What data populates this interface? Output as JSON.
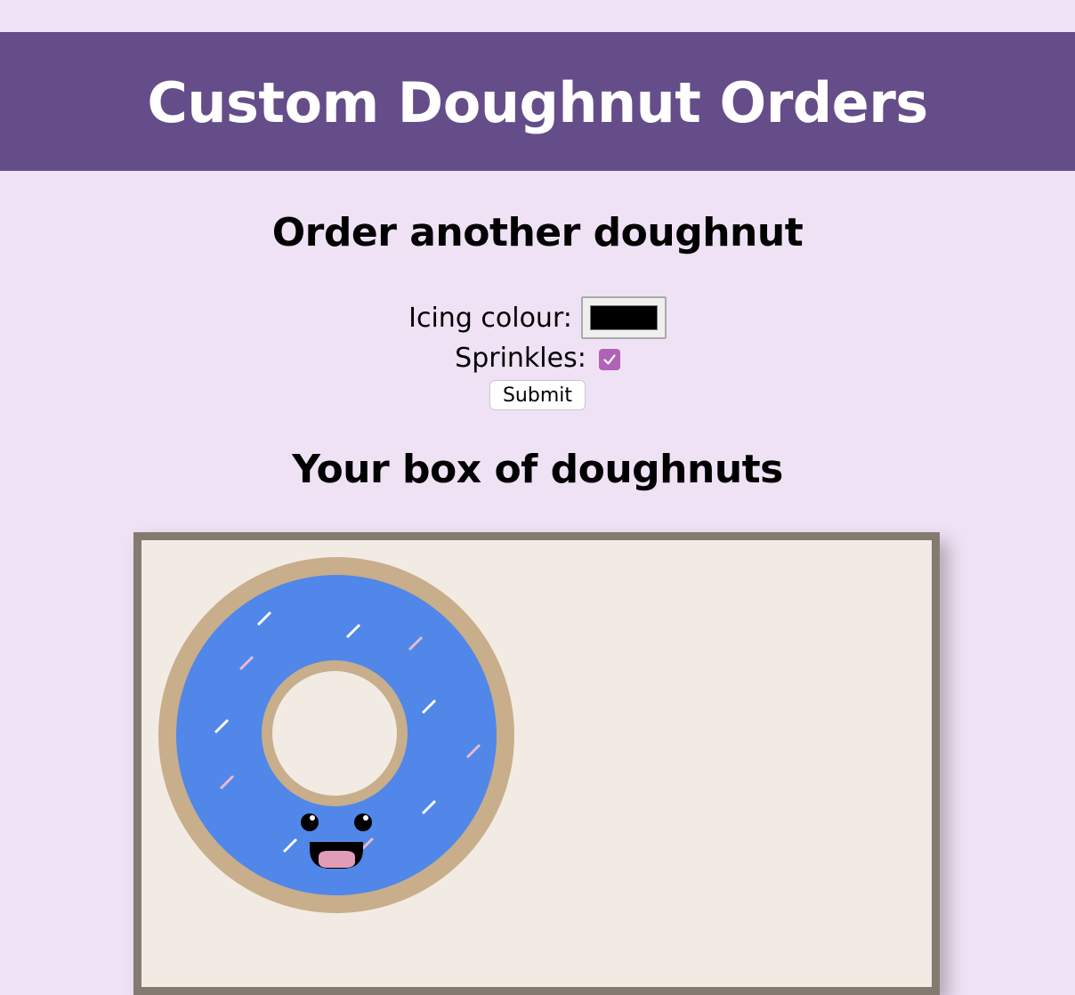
{
  "header": {
    "title": "Custom Doughnut Orders"
  },
  "order_form": {
    "heading": "Order another doughnut",
    "icing_label": "Icing colour:",
    "icing_value": "#000000",
    "sprinkles_label": "Sprinkles:",
    "sprinkles_checked": true,
    "submit_label": "Submit"
  },
  "box": {
    "heading": "Your box of doughnuts",
    "doughnuts": [
      {
        "icing_colour": "#5087e8",
        "sprinkles": true,
        "face": "smiling"
      }
    ]
  },
  "colors": {
    "page_background": "#efe2f5",
    "header_background": "#654d89",
    "checkbox_accent": "#b063b4",
    "box_border": "#847a6f",
    "box_background": "#f1ebe4",
    "dough": "#c8ae8a"
  },
  "icons": {
    "checkbox": "checkmark-icon"
  }
}
